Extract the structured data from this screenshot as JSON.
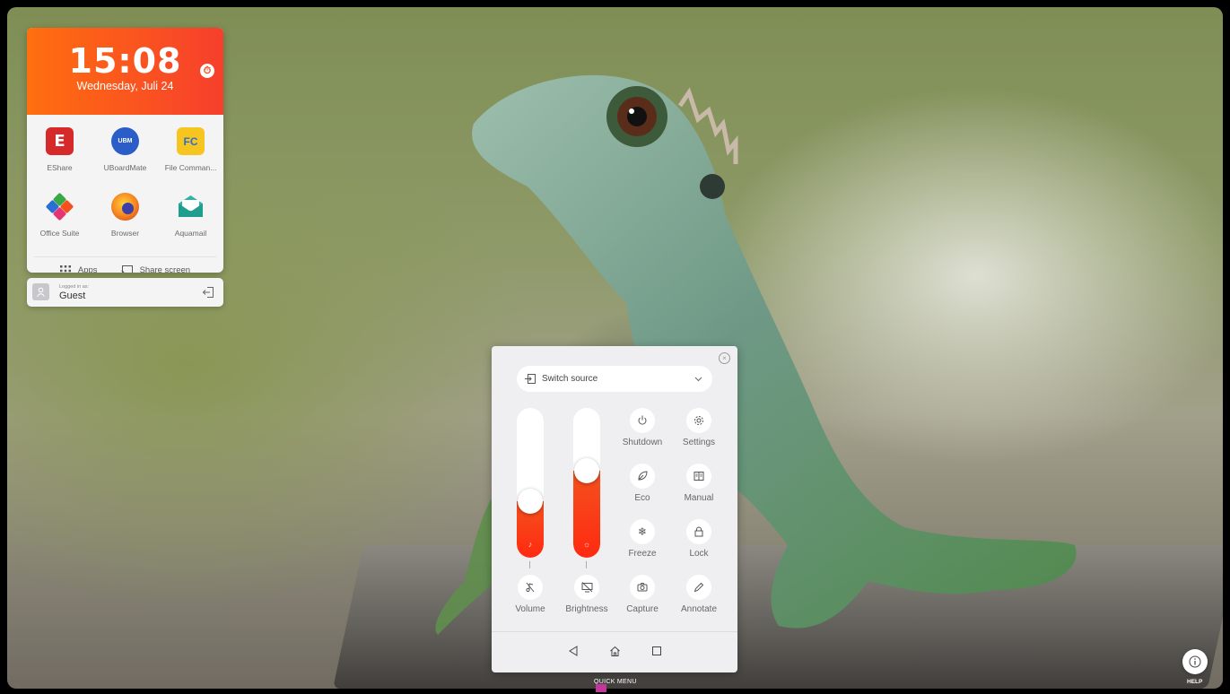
{
  "widget": {
    "time": "15:08",
    "date": "Wednesday, Juli 24",
    "timer_icon": "stopwatch-icon",
    "apps": [
      {
        "label": "EShare",
        "icon": "eshare-icon",
        "color": "#d62a2a"
      },
      {
        "label": "UBoardMate",
        "icon": "uboardmate-icon",
        "color": "#2a5dc8"
      },
      {
        "label": "File Comman...",
        "icon": "file-commander-icon",
        "color": "#f7c51f"
      },
      {
        "label": "Office Suite",
        "icon": "office-suite-icon",
        "color": "#3aa845"
      },
      {
        "label": "Browser",
        "icon": "firefox-icon",
        "color": "#f58220"
      },
      {
        "label": "Aquamail",
        "icon": "aquamail-icon",
        "color": "#2bb5a4"
      }
    ],
    "footer": {
      "apps_label": "Apps",
      "share_label": "Share screen"
    }
  },
  "login": {
    "caption": "Logged in as:",
    "user": "Guest"
  },
  "quick_menu": {
    "source_label": "Switch source",
    "sliders": {
      "volume": {
        "label": "Volume",
        "level": 0.38
      },
      "brightness": {
        "label": "Brightness",
        "level": 0.58
      }
    },
    "buttons": {
      "shutdown": "Shutdown",
      "settings": "Settings",
      "eco": "Eco",
      "manual": "Manual",
      "freeze": "Freeze",
      "lock": "Lock",
      "capture": "Capture",
      "annotate": "Annotate"
    },
    "caption": "QUICK MENU"
  },
  "help": {
    "label": "HELP"
  },
  "colors": {
    "accent_start": "#ff6f0f",
    "accent_end": "#f63f2c",
    "handle": "#c0389a"
  }
}
